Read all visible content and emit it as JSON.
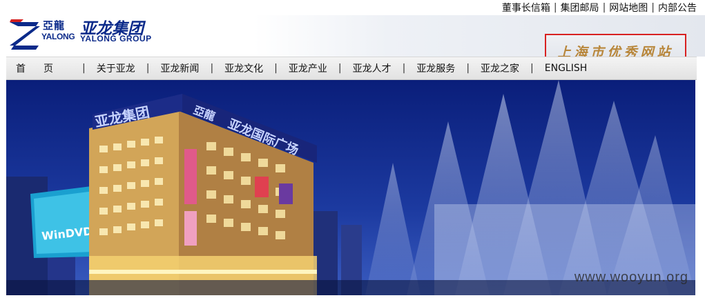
{
  "top_links": [
    "董事长信箱",
    "集团邮局",
    "网站地图",
    "内部公告"
  ],
  "logo": {
    "cn_small": "亞龍",
    "en_small": "YALONG",
    "cn_big": "亚龙集团",
    "en_big": "YALONG GROUP"
  },
  "award_text": "上海市优秀网站",
  "nav": [
    "首页",
    "关于亚龙",
    "亚龙新闻",
    "亚龙文化",
    "亚龙产业",
    "亚龙人才",
    "亚龙服务",
    "亚龙之家",
    "ENGLISH"
  ],
  "banner": {
    "roof_sign_left": "亚龙集团",
    "roof_sign_logo": "亞龍",
    "roof_sign_right": "亚龙国际广场",
    "billboard_text": "WinDVD"
  },
  "watermark": "www.wooyun.org",
  "colors": {
    "brand_blue": "#0b2a8a",
    "award_border": "#d82020",
    "award_text": "#b8863a",
    "sky": "#0a1d73"
  }
}
